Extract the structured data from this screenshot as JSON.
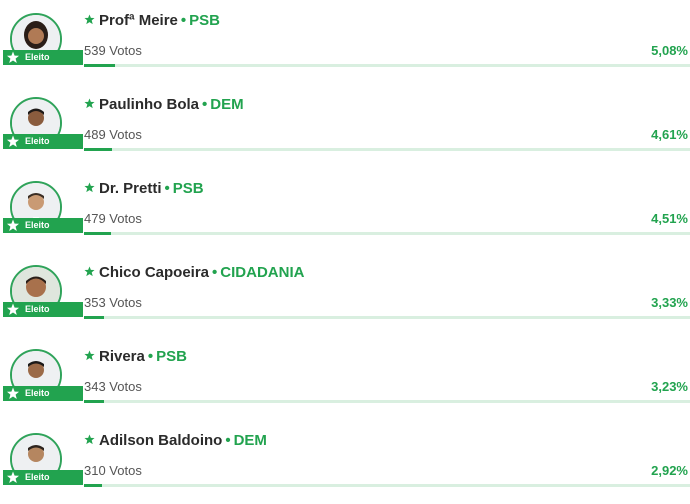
{
  "candidates": [
    {
      "name": "Profª Meire",
      "party": "PSB",
      "votes": "539 Votos",
      "percent": "5,08%",
      "percent_value": 5.08,
      "status": "Eleito",
      "avatar_icon": "candidate-photo"
    },
    {
      "name": "Paulinho Bola",
      "party": "DEM",
      "votes": "489 Votos",
      "percent": "4,61%",
      "percent_value": 4.61,
      "status": "Eleito",
      "avatar_icon": "candidate-photo"
    },
    {
      "name": "Dr. Pretti",
      "party": "PSB",
      "votes": "479 Votos",
      "percent": "4,51%",
      "percent_value": 4.51,
      "status": "Eleito",
      "avatar_icon": "candidate-photo"
    },
    {
      "name": "Chico Capoeira",
      "party": "CIDADANIA",
      "votes": "353 Votos",
      "percent": "3,33%",
      "percent_value": 3.33,
      "status": "Eleito",
      "avatar_icon": "candidate-photo"
    },
    {
      "name": "Rivera",
      "party": "PSB",
      "votes": "343 Votos",
      "percent": "3,23%",
      "percent_value": 3.23,
      "status": "Eleito",
      "avatar_icon": "candidate-photo"
    },
    {
      "name": "Adilson Baldoino",
      "party": "DEM",
      "votes": "310 Votos",
      "percent": "2,92%",
      "percent_value": 2.92,
      "status": "Eleito",
      "avatar_icon": "candidate-photo"
    }
  ],
  "colors": {
    "accent": "#22a34f",
    "bar_track": "#d9efe0",
    "text": "#2b2b2b"
  }
}
